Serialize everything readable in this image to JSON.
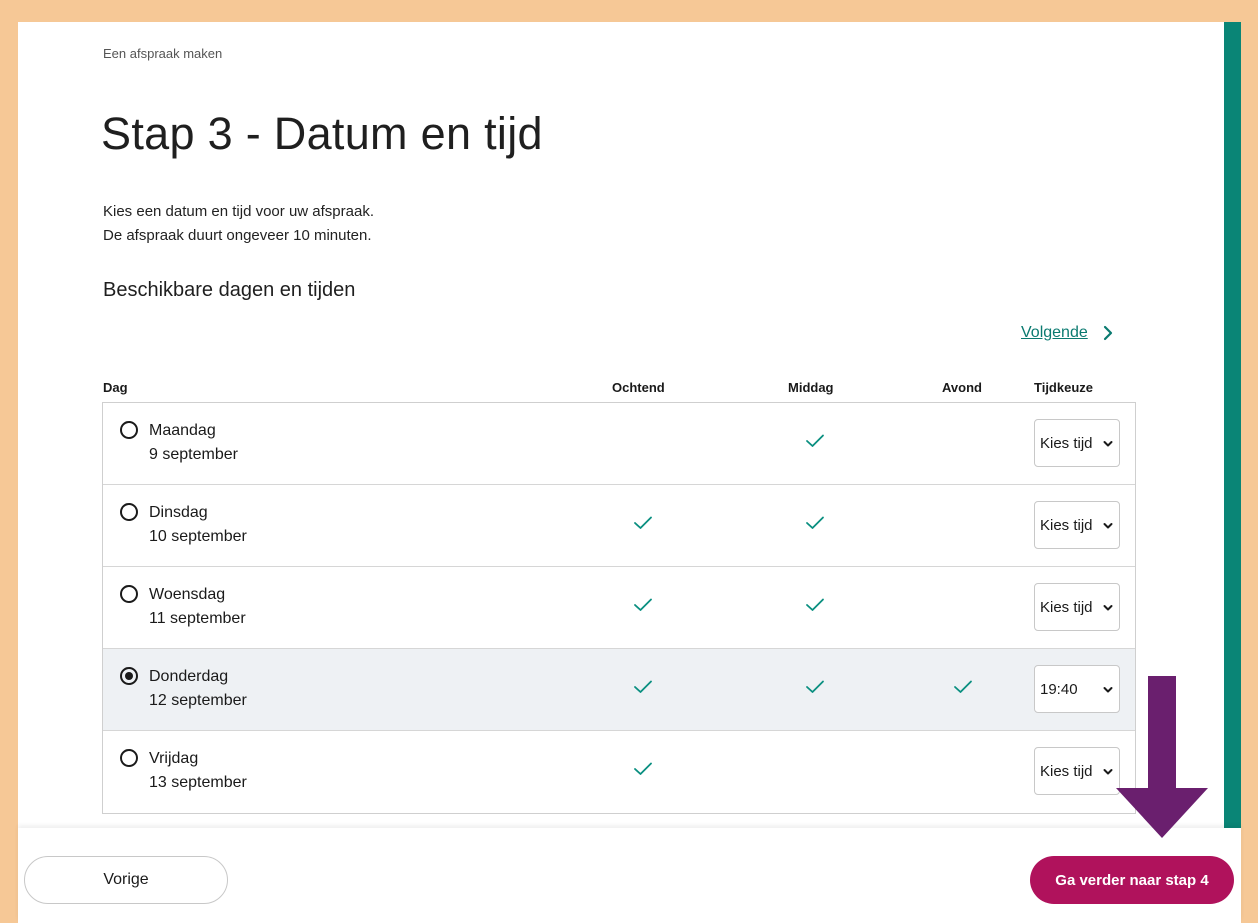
{
  "breadcrumb": "Een afspraak maken",
  "page_title": "Stap 3 - Datum en tijd",
  "intro": {
    "line1": "Kies een datum en tijd voor uw afspraak.",
    "line2": "De afspraak duurt ongeveer 10 minuten."
  },
  "section_title": "Beschikbare dagen en tijden",
  "next_link": "Volgende",
  "table": {
    "headers": {
      "dag": "Dag",
      "ochtend": "Ochtend",
      "middag": "Middag",
      "avond": "Avond",
      "tijdkeuze": "Tijdkeuze"
    },
    "rows": [
      {
        "day": "Maandag",
        "date": "9 september",
        "ochtend": false,
        "middag": true,
        "avond": false,
        "selected": false,
        "time": "Kies tijd"
      },
      {
        "day": "Dinsdag",
        "date": "10 september",
        "ochtend": true,
        "middag": true,
        "avond": false,
        "selected": false,
        "time": "Kies tijd"
      },
      {
        "day": "Woensdag",
        "date": "11 september",
        "ochtend": true,
        "middag": true,
        "avond": false,
        "selected": false,
        "time": "Kies tijd"
      },
      {
        "day": "Donderdag",
        "date": "12 september",
        "ochtend": true,
        "middag": true,
        "avond": true,
        "selected": true,
        "time": "19:40"
      },
      {
        "day": "Vrijdag",
        "date": "13 september",
        "ochtend": true,
        "middag": false,
        "avond": false,
        "selected": false,
        "time": "Kies tijd"
      }
    ]
  },
  "footer": {
    "prev_label": "Vorige",
    "next_label": "Ga verder naar stap 4"
  },
  "colors": {
    "accent_green": "#0a8576",
    "check_green": "#0a8f80",
    "primary_button": "#b0125c",
    "arrow_purple": "#6a1f6e",
    "frame": "#f6c896",
    "selected_row": "#eef1f4"
  },
  "icons": {
    "next": "chevron-right-icon",
    "check": "check-icon",
    "select": "chevron-down-icon",
    "annotation": "arrow-down-icon"
  }
}
